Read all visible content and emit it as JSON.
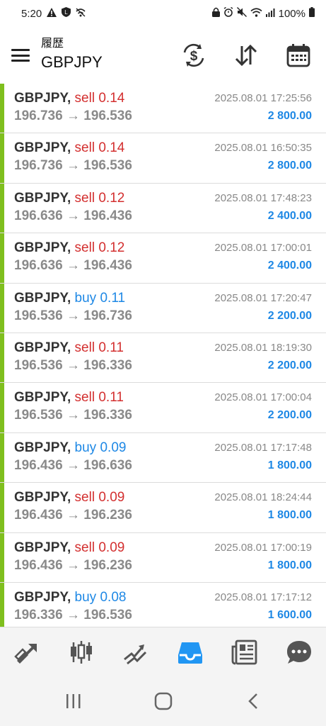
{
  "status": {
    "time": "5:20",
    "battery": "100%"
  },
  "header": {
    "title_small": "履歴",
    "title_big": "GBPJPY"
  },
  "arrow": "→",
  "rows": [
    {
      "symbol": "GBPJPY,",
      "side": "sell",
      "volume": "0.14",
      "open": "196.736",
      "close": "196.536",
      "time": "2025.08.01 17:25:56",
      "profit": "2 800.00"
    },
    {
      "symbol": "GBPJPY,",
      "side": "sell",
      "volume": "0.14",
      "open": "196.736",
      "close": "196.536",
      "time": "2025.08.01 16:50:35",
      "profit": "2 800.00"
    },
    {
      "symbol": "GBPJPY,",
      "side": "sell",
      "volume": "0.12",
      "open": "196.636",
      "close": "196.436",
      "time": "2025.08.01 17:48:23",
      "profit": "2 400.00"
    },
    {
      "symbol": "GBPJPY,",
      "side": "sell",
      "volume": "0.12",
      "open": "196.636",
      "close": "196.436",
      "time": "2025.08.01 17:00:01",
      "profit": "2 400.00"
    },
    {
      "symbol": "GBPJPY,",
      "side": "buy",
      "volume": "0.11",
      "open": "196.536",
      "close": "196.736",
      "time": "2025.08.01 17:20:47",
      "profit": "2 200.00"
    },
    {
      "symbol": "GBPJPY,",
      "side": "sell",
      "volume": "0.11",
      "open": "196.536",
      "close": "196.336",
      "time": "2025.08.01 18:19:30",
      "profit": "2 200.00"
    },
    {
      "symbol": "GBPJPY,",
      "side": "sell",
      "volume": "0.11",
      "open": "196.536",
      "close": "196.336",
      "time": "2025.08.01 17:00:04",
      "profit": "2 200.00"
    },
    {
      "symbol": "GBPJPY,",
      "side": "buy",
      "volume": "0.09",
      "open": "196.436",
      "close": "196.636",
      "time": "2025.08.01 17:17:48",
      "profit": "1 800.00"
    },
    {
      "symbol": "GBPJPY,",
      "side": "sell",
      "volume": "0.09",
      "open": "196.436",
      "close": "196.236",
      "time": "2025.08.01 18:24:44",
      "profit": "1 800.00"
    },
    {
      "symbol": "GBPJPY,",
      "side": "sell",
      "volume": "0.09",
      "open": "196.436",
      "close": "196.236",
      "time": "2025.08.01 17:00:19",
      "profit": "1 800.00"
    },
    {
      "symbol": "GBPJPY,",
      "side": "buy",
      "volume": "0.08",
      "open": "196.336",
      "close": "196.536",
      "time": "2025.08.01 17:17:12",
      "profit": "1 600.00"
    }
  ],
  "colors": {
    "sell": "#d32f2f",
    "buy": "#1e88e5",
    "accent_bar": "#7fbf1e",
    "active_tab": "#2196f3"
  },
  "tabs": [
    {
      "icon": "quotes-icon",
      "active": false
    },
    {
      "icon": "chart-icon",
      "active": false
    },
    {
      "icon": "trade-icon",
      "active": false
    },
    {
      "icon": "history-icon",
      "active": true
    },
    {
      "icon": "news-icon",
      "active": false
    },
    {
      "icon": "messages-icon",
      "active": false
    }
  ]
}
